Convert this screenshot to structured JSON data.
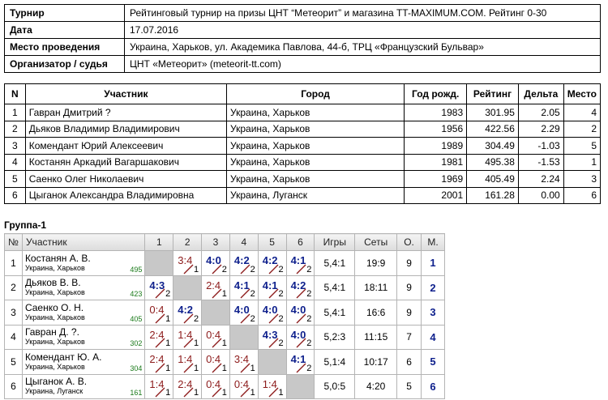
{
  "info": [
    {
      "label": "Турнир",
      "value": "Рейтинговый турнир на призы ЦНТ “Метеорит” и магазина TT-MAXIMUM.COM. Рейтинг 0-30"
    },
    {
      "label": "Дата",
      "value": "17.07.2016"
    },
    {
      "label": "Место проведения",
      "value": "Украина, Харьков, ул. Академика Павлова, 44-б, ТРЦ «Французский Бульвар»"
    },
    {
      "label": "Организатор / судья",
      "value": "ЦНТ «Метеорит» (meteorit-tt.com)"
    }
  ],
  "participants": {
    "headers": [
      "N",
      "Участник",
      "Город",
      "Год рожд.",
      "Рейтинг",
      "Дельта",
      "Место"
    ],
    "rows": [
      [
        "1",
        "Гавран Дмитрий ?",
        "Украина, Харьков",
        "1983",
        "301.95",
        "2.05",
        "4"
      ],
      [
        "2",
        "Дьяков Владимир Владимирович",
        "Украина, Харьков",
        "1956",
        "422.56",
        "2.29",
        "2"
      ],
      [
        "3",
        "Комендант Юрий Алексеевич",
        "Украина, Харьков",
        "1989",
        "304.49",
        "-1.03",
        "5"
      ],
      [
        "4",
        "Костанян Аркадий Вагаршакович",
        "Украина, Харьков",
        "1981",
        "495.38",
        "-1.53",
        "1"
      ],
      [
        "5",
        "Саенко Олег Николаевич",
        "Украина, Харьков",
        "1969",
        "405.49",
        "2.24",
        "3"
      ],
      [
        "6",
        "Цыганок Александра Владимировна",
        "Украина, Луганск",
        "2001",
        "161.28",
        "0.00",
        "6"
      ]
    ]
  },
  "group": {
    "title": "Группа-1",
    "headers": [
      "№",
      "Участник",
      "1",
      "2",
      "3",
      "4",
      "5",
      "6",
      "Игры",
      "Сеты",
      "О.",
      "М."
    ],
    "rows": [
      {
        "n": "1",
        "name": "Костанян А. В.",
        "city": "Украина, Харьков",
        "rating": "495",
        "results": [
          null,
          {
            "s": "3:4",
            "p": "1",
            "w": false
          },
          {
            "s": "4:0",
            "p": "2",
            "w": true
          },
          {
            "s": "4:2",
            "p": "2",
            "w": true
          },
          {
            "s": "4:2",
            "p": "2",
            "w": true
          },
          {
            "s": "4:1",
            "p": "2",
            "w": true
          }
        ],
        "games": "5,4:1",
        "sets": "19:9",
        "points": "9",
        "place": "1"
      },
      {
        "n": "2",
        "name": "Дьяков В. В.",
        "city": "Украина, Харьков",
        "rating": "423",
        "results": [
          {
            "s": "4:3",
            "p": "2",
            "w": true
          },
          null,
          {
            "s": "2:4",
            "p": "1",
            "w": false
          },
          {
            "s": "4:1",
            "p": "2",
            "w": true
          },
          {
            "s": "4:1",
            "p": "2",
            "w": true
          },
          {
            "s": "4:2",
            "p": "2",
            "w": true
          }
        ],
        "games": "5,4:1",
        "sets": "18:11",
        "points": "9",
        "place": "2"
      },
      {
        "n": "3",
        "name": "Саенко О. Н.",
        "city": "Украина, Харьков",
        "rating": "405",
        "results": [
          {
            "s": "0:4",
            "p": "1",
            "w": false
          },
          {
            "s": "4:2",
            "p": "2",
            "w": true
          },
          null,
          {
            "s": "4:0",
            "p": "2",
            "w": true
          },
          {
            "s": "4:0",
            "p": "2",
            "w": true
          },
          {
            "s": "4:0",
            "p": "2",
            "w": true
          }
        ],
        "games": "5,4:1",
        "sets": "16:6",
        "points": "9",
        "place": "3"
      },
      {
        "n": "4",
        "name": "Гавран Д. ?.",
        "city": "Украина, Харьков",
        "rating": "302",
        "results": [
          {
            "s": "2:4",
            "p": "1",
            "w": false
          },
          {
            "s": "1:4",
            "p": "1",
            "w": false
          },
          {
            "s": "0:4",
            "p": "1",
            "w": false
          },
          null,
          {
            "s": "4:3",
            "p": "2",
            "w": true
          },
          {
            "s": "4:0",
            "p": "2",
            "w": true
          }
        ],
        "games": "5,2:3",
        "sets": "11:15",
        "points": "7",
        "place": "4"
      },
      {
        "n": "5",
        "name": "Комендант Ю. А.",
        "city": "Украина, Харьков",
        "rating": "304",
        "results": [
          {
            "s": "2:4",
            "p": "1",
            "w": false
          },
          {
            "s": "1:4",
            "p": "1",
            "w": false
          },
          {
            "s": "0:4",
            "p": "1",
            "w": false
          },
          {
            "s": "3:4",
            "p": "1",
            "w": false
          },
          null,
          {
            "s": "4:1",
            "p": "2",
            "w": true
          }
        ],
        "games": "5,1:4",
        "sets": "10:17",
        "points": "6",
        "place": "5"
      },
      {
        "n": "6",
        "name": "Цыганок А. В.",
        "city": "Украина, Луганск",
        "rating": "161",
        "results": [
          {
            "s": "1:4",
            "p": "1",
            "w": false
          },
          {
            "s": "2:4",
            "p": "1",
            "w": false
          },
          {
            "s": "0:4",
            "p": "1",
            "w": false
          },
          {
            "s": "0:4",
            "p": "1",
            "w": false
          },
          {
            "s": "1:4",
            "p": "1",
            "w": false
          },
          null
        ],
        "games": "5,0:5",
        "sets": "4:20",
        "points": "5",
        "place": "6"
      }
    ]
  }
}
